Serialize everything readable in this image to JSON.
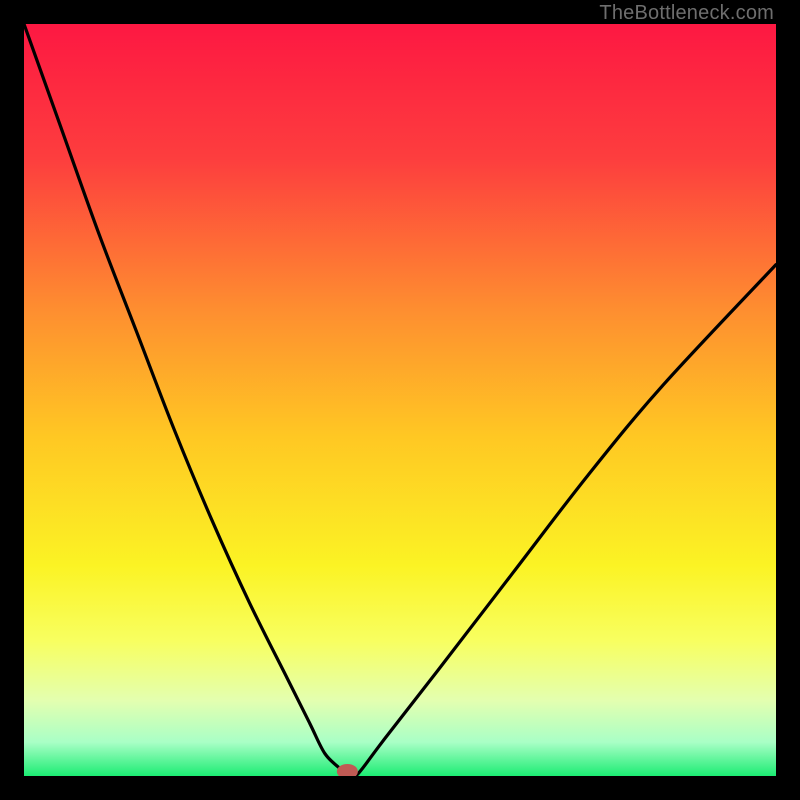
{
  "watermark": "TheBottleneck.com",
  "chart_data": {
    "type": "line",
    "title": "",
    "xlabel": "",
    "ylabel": "",
    "xlim": [
      0,
      100
    ],
    "ylim": [
      0,
      100
    ],
    "grid": false,
    "legend": false,
    "series": [
      {
        "name": "bottleneck-curve",
        "x": [
          0,
          5,
          10,
          15,
          20,
          25,
          30,
          35,
          38,
          40,
          42,
          43,
          44,
          45,
          48,
          55,
          65,
          75,
          85,
          100
        ],
        "y": [
          100,
          86,
          72,
          59,
          46,
          34,
          23,
          13,
          7,
          3,
          1,
          0,
          0,
          1,
          5,
          14,
          27,
          40,
          52,
          68
        ]
      }
    ],
    "marker": {
      "name": "optimal-point",
      "x": 43,
      "y": 0,
      "color": "#c05a54"
    },
    "background_gradient_stops": [
      {
        "pos": 0.0,
        "color": "#fd1842"
      },
      {
        "pos": 0.18,
        "color": "#fd3e3e"
      },
      {
        "pos": 0.38,
        "color": "#fe8e30"
      },
      {
        "pos": 0.55,
        "color": "#ffc823"
      },
      {
        "pos": 0.72,
        "color": "#fbf324"
      },
      {
        "pos": 0.82,
        "color": "#f8ff60"
      },
      {
        "pos": 0.9,
        "color": "#e3ffb0"
      },
      {
        "pos": 0.955,
        "color": "#a9ffc6"
      },
      {
        "pos": 1.0,
        "color": "#1cec73"
      }
    ]
  }
}
